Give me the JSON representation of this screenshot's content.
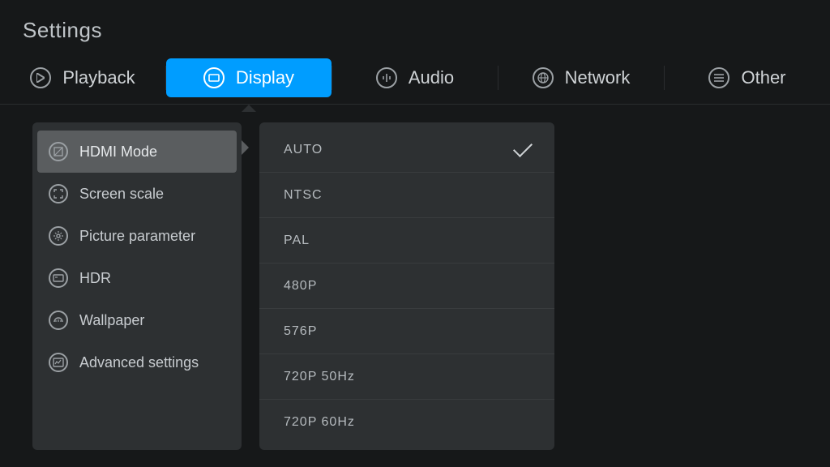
{
  "header": {
    "title": "Settings"
  },
  "tabs": [
    {
      "label": "Playback",
      "icon": "play-icon",
      "active": false
    },
    {
      "label": "Display",
      "icon": "display-icon",
      "active": true
    },
    {
      "label": "Audio",
      "icon": "audio-icon",
      "active": false
    },
    {
      "label": "Network",
      "icon": "network-icon",
      "active": false
    },
    {
      "label": "Other",
      "icon": "menu-icon",
      "active": false
    }
  ],
  "sidebar": {
    "items": [
      {
        "label": "HDMI Mode",
        "icon": "hdmi-icon",
        "selected": true
      },
      {
        "label": "Screen scale",
        "icon": "scale-icon",
        "selected": false
      },
      {
        "label": "Picture parameter",
        "icon": "picture-icon",
        "selected": false
      },
      {
        "label": "HDR",
        "icon": "hdr-icon",
        "selected": false
      },
      {
        "label": "Wallpaper",
        "icon": "wallpaper-icon",
        "selected": false
      },
      {
        "label": "Advanced settings",
        "icon": "advanced-icon",
        "selected": false
      }
    ]
  },
  "options": {
    "items": [
      {
        "label": "AUTO",
        "selected": true
      },
      {
        "label": "NTSC",
        "selected": false
      },
      {
        "label": "PAL",
        "selected": false
      },
      {
        "label": "480P",
        "selected": false
      },
      {
        "label": "576P",
        "selected": false
      },
      {
        "label": "720P  50Hz",
        "selected": false
      },
      {
        "label": "720P  60Hz",
        "selected": false
      }
    ]
  }
}
